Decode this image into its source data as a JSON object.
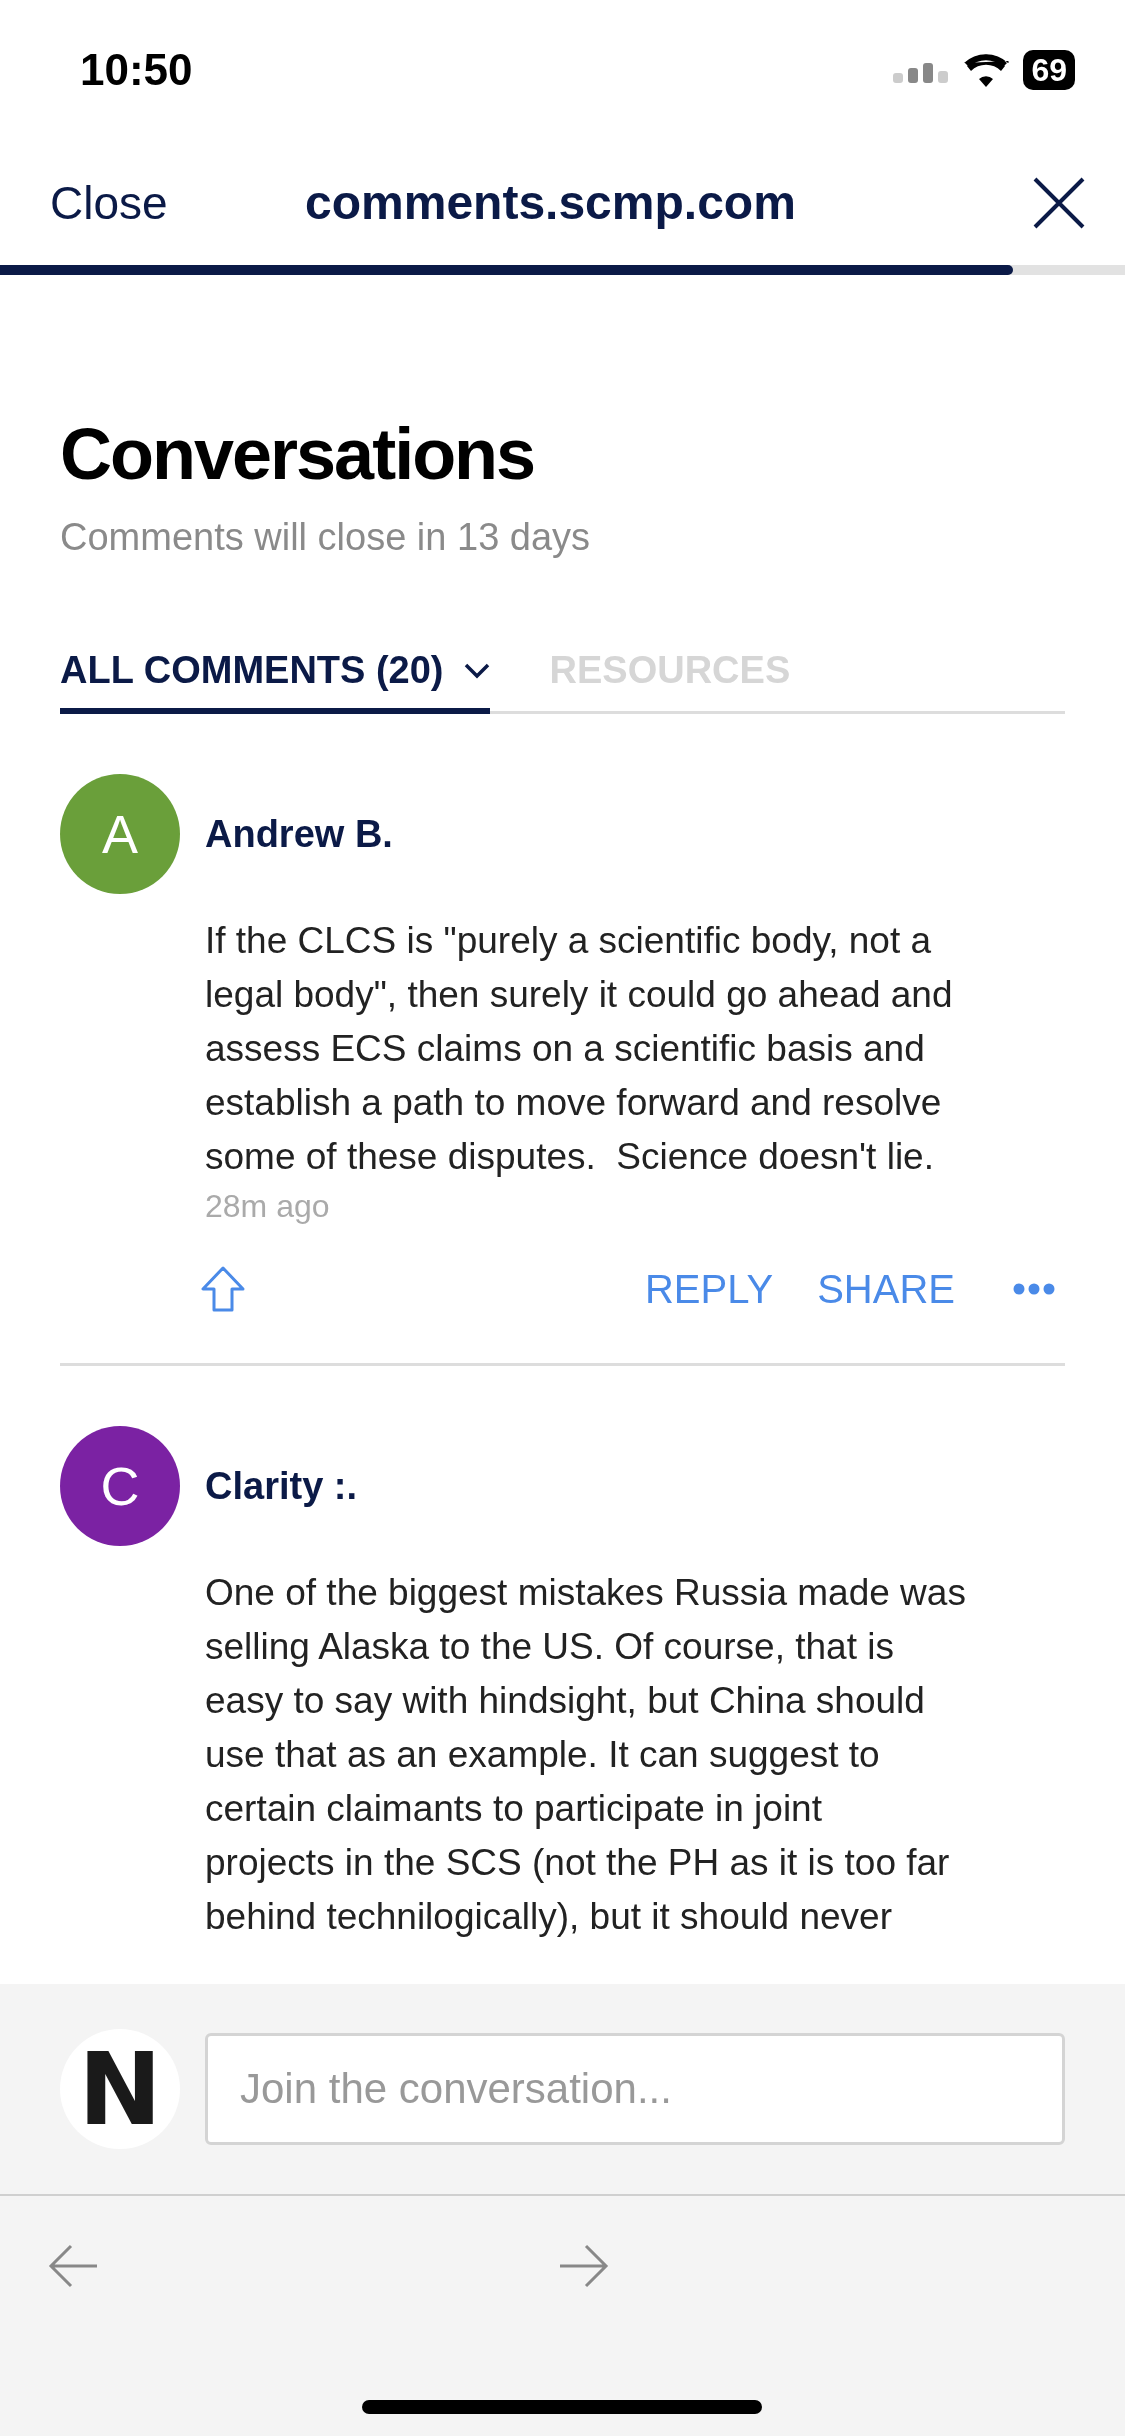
{
  "status_bar": {
    "time": "10:50",
    "battery": "69"
  },
  "browser_bar": {
    "close_label": "Close",
    "domain": "comments.scmp.com",
    "progress": {
      "level": 0.9
    }
  },
  "header": {
    "title": "Conversations",
    "subtitle": "Comments will close in 13 days"
  },
  "tabs": [
    {
      "label": "ALL COMMENTS (20)",
      "selected": true,
      "has_dropdown": true
    },
    {
      "label": "RESOURCES",
      "selected": false,
      "has_dropdown": false
    }
  ],
  "comments": [
    {
      "initial": "A",
      "color": "#6a9f3a",
      "author": "Andrew B.",
      "body_lines": [
        "If the CLCS is \"purely a scientific body, not a",
        "legal body\", then surely it could go ahead and",
        "assess ECS claims on a scientific basis and",
        "establish a path to move forward and resolve",
        "some of these disputes.  Science doesn't lie."
      ],
      "time": "28m ago",
      "actions": [
        "REPLY",
        "SHARE"
      ]
    },
    {
      "initial": "C",
      "color": "#7b22a3",
      "author": "Clarity :.",
      "body_lines": [
        "One of the biggest mistakes Russia made was",
        "selling Alaska to the US. Of course, that is",
        "easy to say with hindsight, but China should",
        "use that as an example. It can suggest to",
        "certain claimants to participate in joint",
        "projects in the SCS (not the PH as it is too far",
        "behind technilogically), but it should never"
      ]
    }
  ],
  "composer": {
    "avatar_initial": "N",
    "placeholder": "Join the conversation..."
  }
}
